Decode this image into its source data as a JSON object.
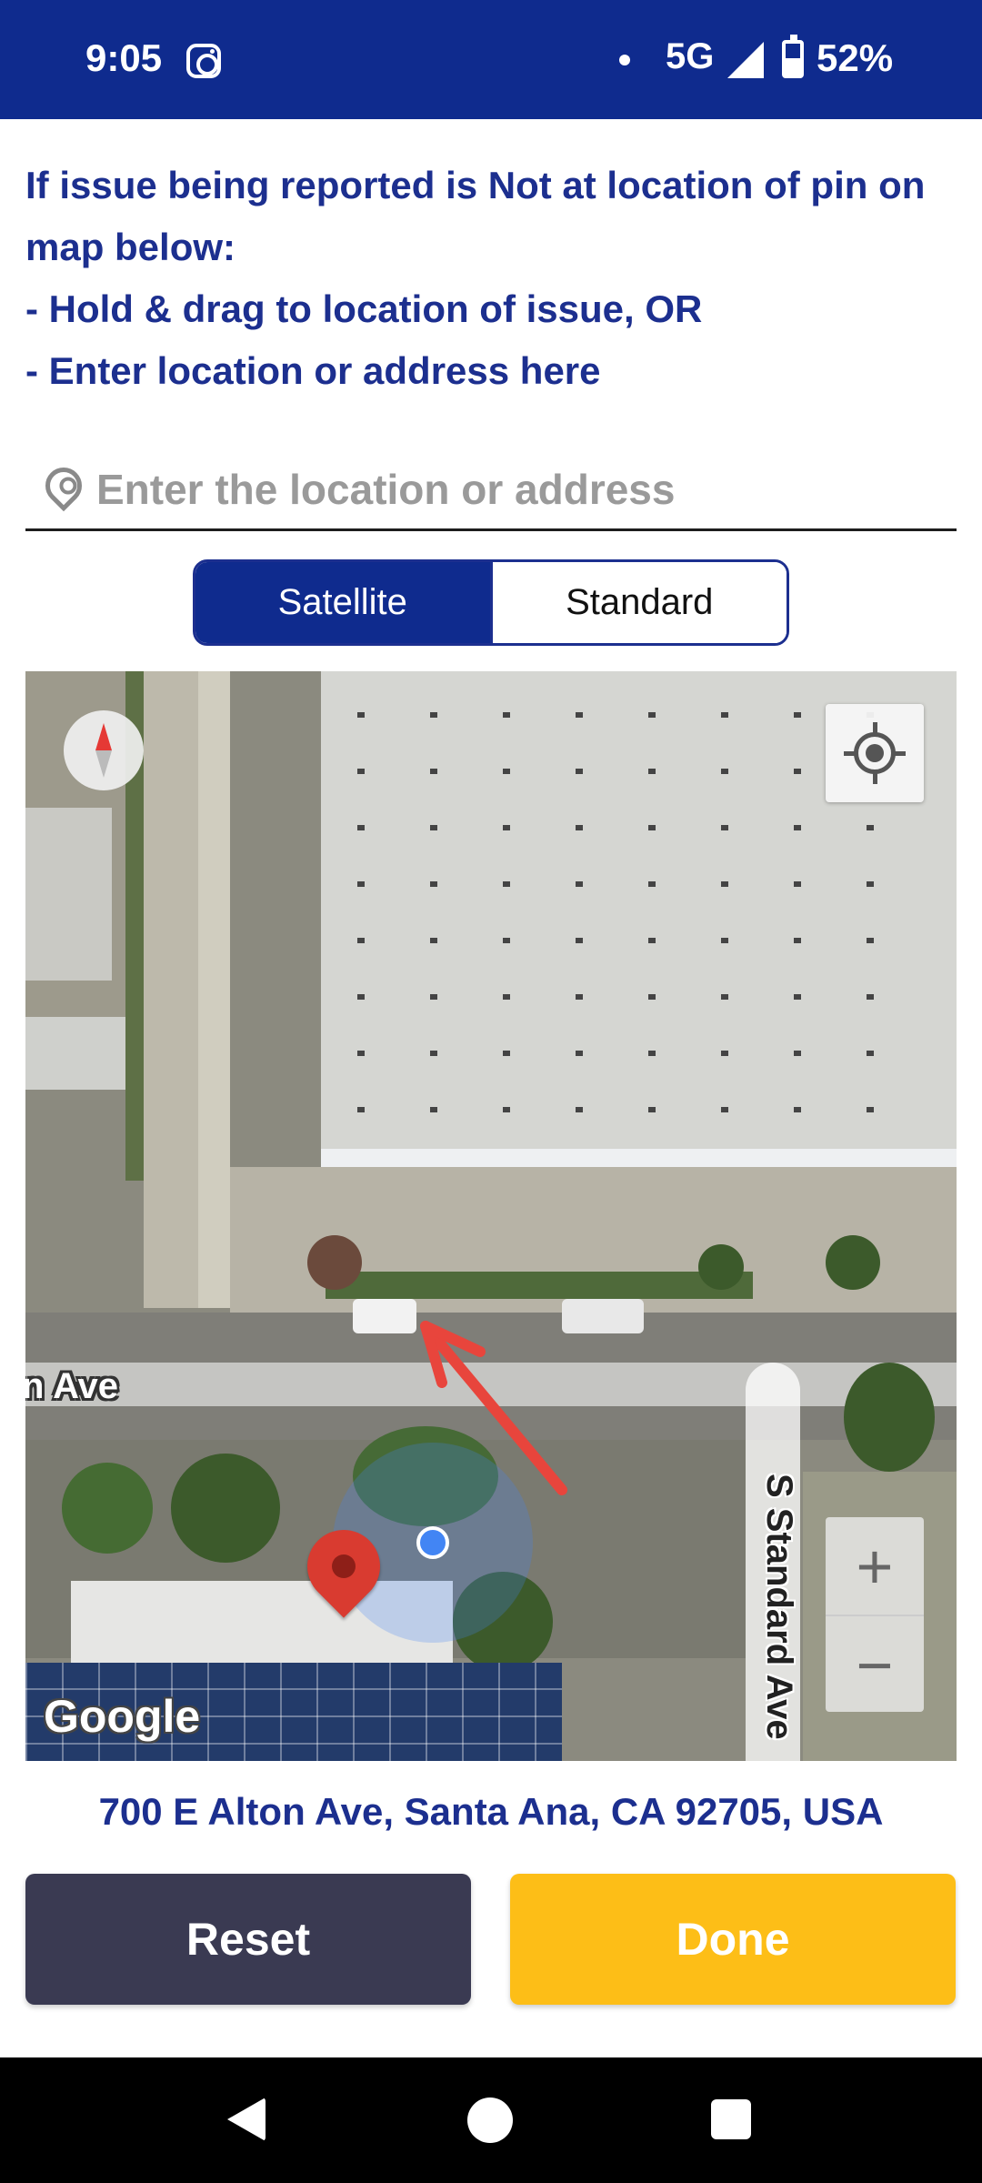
{
  "status_bar": {
    "time": "9:05",
    "network": "5G",
    "battery": "52%",
    "battery_level": 0.52,
    "notification_icon": "instagram-icon"
  },
  "instructions": {
    "line1": "If issue being reported is Not at location of pin on map below:",
    "line2": "- Hold & drag to location of issue, OR",
    "line3": "- Enter location or address here"
  },
  "search": {
    "placeholder": "Enter the location or address",
    "value": "",
    "icon": "location-pin-icon"
  },
  "map_type": {
    "options": [
      "Satellite",
      "Standard"
    ],
    "selected": "Satellite"
  },
  "map": {
    "street_horizontal": "n Ave",
    "street_vertical": "S Standard Ave",
    "provider_logo": "Google",
    "zoom_in": "+",
    "zoom_out": "−"
  },
  "address": "700 E Alton Ave, Santa Ana, CA 92705, USA",
  "buttons": {
    "reset": "Reset",
    "done": "Done"
  },
  "colors": {
    "primary": "#0F2B8E",
    "heading_text": "#1C2F8F",
    "done": "#FDBE17",
    "reset": "#3a3a52",
    "marker": "#D93B30",
    "annotation_arrow": "#E8453C"
  }
}
